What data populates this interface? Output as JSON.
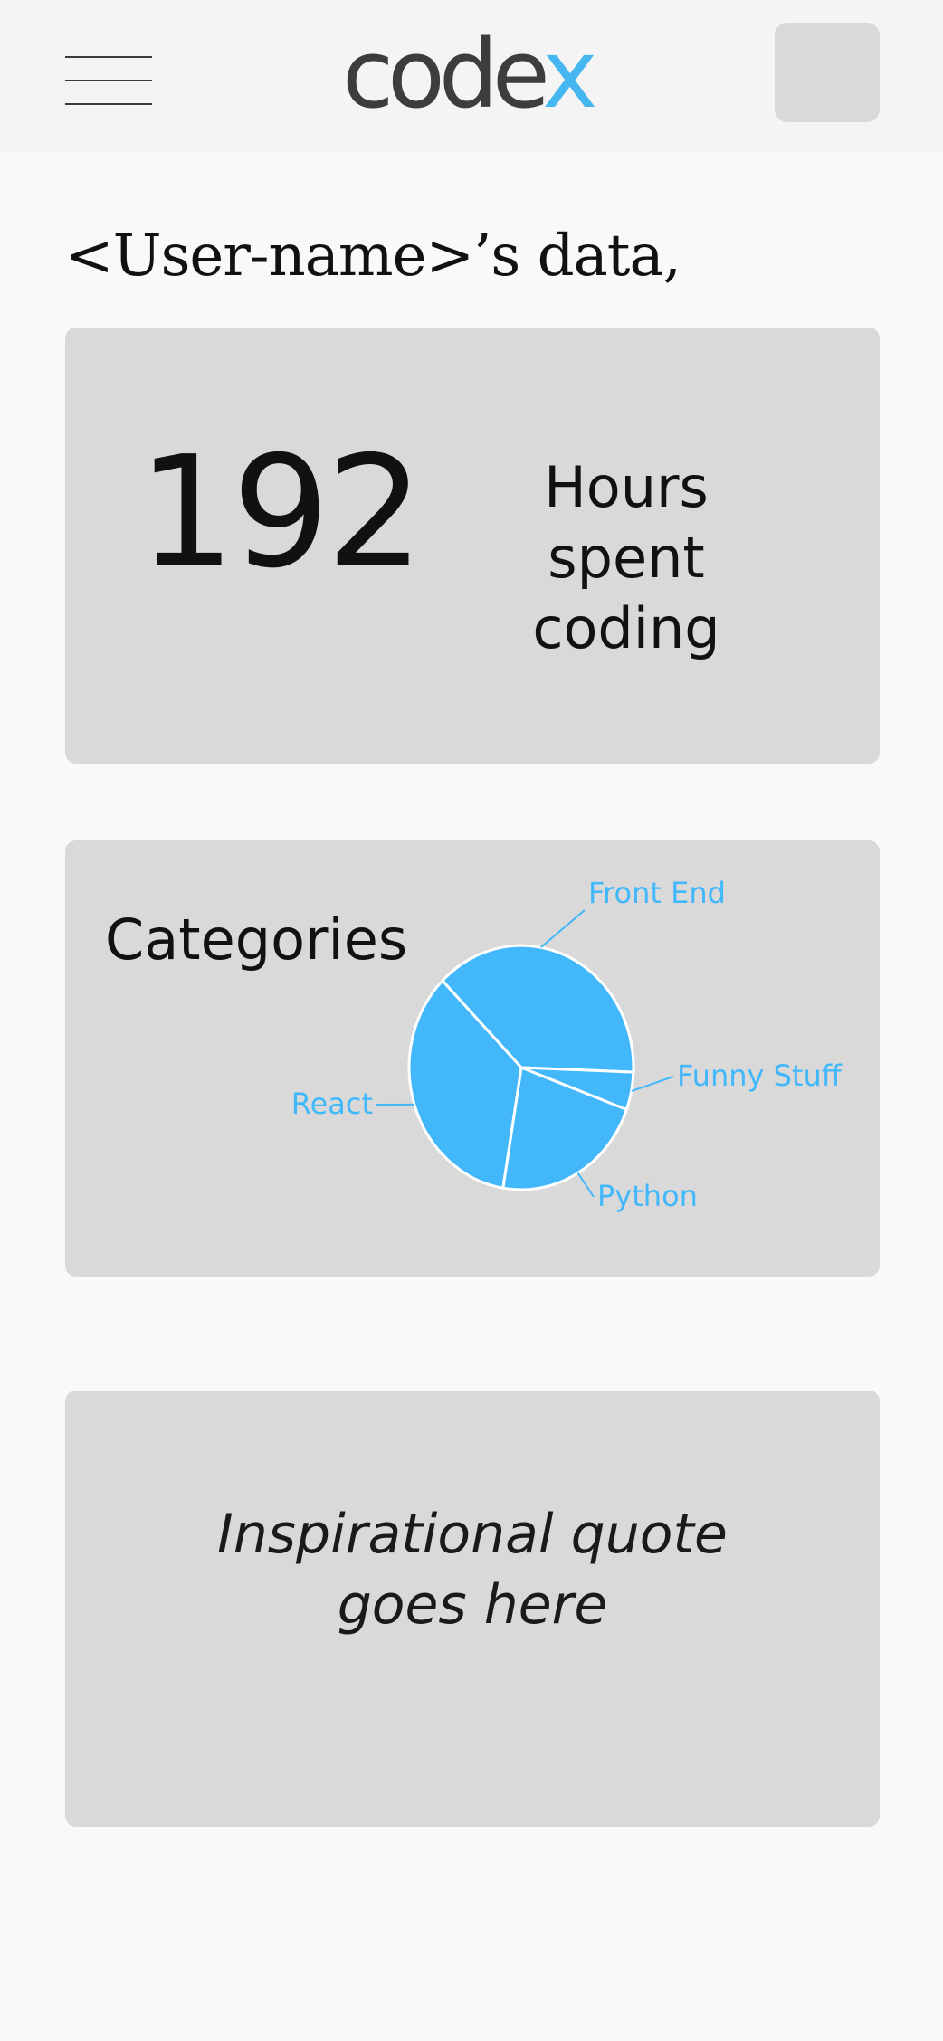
{
  "header": {
    "menu_icon": "hamburger-menu-icon",
    "logo": {
      "main": "code",
      "accent": "x",
      "accent_color": "#46b6f0"
    }
  },
  "greeting": "<User-name>’s data,",
  "hours_card": {
    "value": "192",
    "label": "Hours spent coding"
  },
  "categories_card": {
    "title": "Categories"
  },
  "chart_data": {
    "type": "pie",
    "color": "#42b8fa",
    "slices": [
      {
        "label": "Front End",
        "value": 38
      },
      {
        "label": "Funny Stuff",
        "value": 5
      },
      {
        "label": "Python",
        "value": 22
      },
      {
        "label": "React",
        "value": 35
      }
    ]
  },
  "quote_card": {
    "text": "Inspirational quote goes here"
  }
}
